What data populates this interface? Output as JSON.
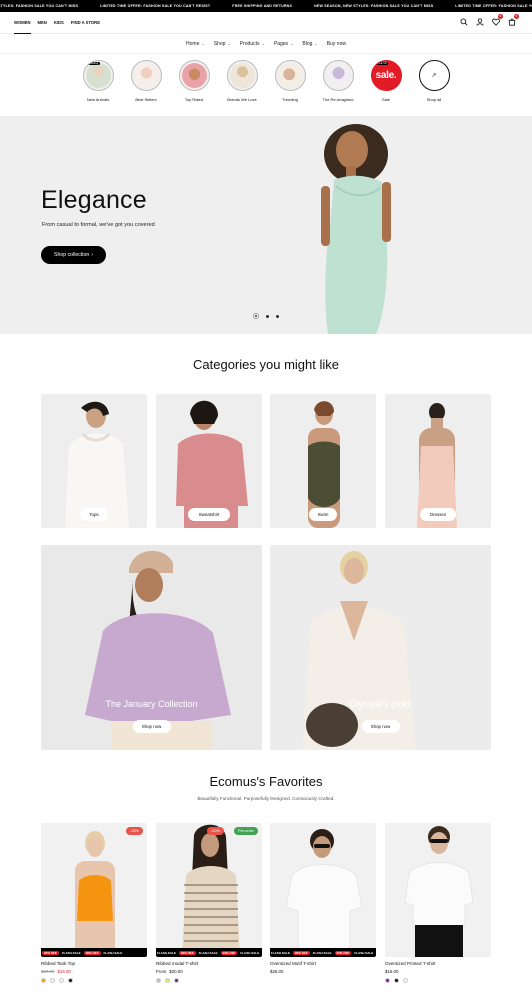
{
  "announcement": [
    "STYLES: FASHION SALE YOU CAN'T MISS",
    "LIMITED TIME OFFER: FASHION SALE YOU CAN'T RESIST",
    "FREE SHIPPING AND RETURNS",
    "NEW SEASON, NEW STYLES: FASHION SALE YOU CAN'T MISS",
    "LIMITED TIME OFFER: FASHION SALE YOU CAN'T RESIST"
  ],
  "topnav": [
    "WOMEN",
    "MEN",
    "KIDS",
    "FIND A STORE"
  ],
  "header": {
    "cart_count": "0",
    "wishlist_count": "0"
  },
  "mainnav": [
    {
      "label": "Home"
    },
    {
      "label": "Shop"
    },
    {
      "label": "Products"
    },
    {
      "label": "Pages"
    },
    {
      "label": "Blog"
    },
    {
      "label": "Buy now"
    }
  ],
  "stories": [
    {
      "label": "New Arrivals",
      "tag": "Trending"
    },
    {
      "label": "Best Sellers"
    },
    {
      "label": "Top Rated"
    },
    {
      "label": "Brands We Love"
    },
    {
      "label": "Trending"
    },
    {
      "label": "The Re-Imagined"
    },
    {
      "label": "Sale",
      "tag": "SALE UP",
      "circle_text": "sale."
    },
    {
      "label": "Shop all",
      "circle_text": "↗"
    }
  ],
  "hero": {
    "title": "Elegance",
    "subtitle": "From casual to formal, we've got you covered",
    "button": "Shop collection",
    "button_arrow": "›"
  },
  "categories": {
    "title": "Categories you might like",
    "items": [
      {
        "label": "Tops"
      },
      {
        "label": "Sweatshirt"
      },
      {
        "label": "Swim"
      },
      {
        "label": "Dresses"
      }
    ],
    "features": [
      {
        "caption": "The January Collection",
        "button": "Shop now"
      },
      {
        "caption": "Olympia's picks",
        "button": "Shop now"
      }
    ]
  },
  "favorites": {
    "title": "Ecomus's Favorites",
    "subtitle": "Beautifully Functional. Purposefully Designed. Consciously Crafted.",
    "products": [
      {
        "name": "Ribbed Tank Top",
        "old_price": "$20.00",
        "price": "$16.00",
        "badges": [
          {
            "text": "-33%",
            "color": "#e8534a"
          }
        ],
        "ticker": [
          "20% OFF",
          "FLASH SALE",
          "20% OFF",
          "FLASH SALE"
        ],
        "swatches": [
          "#f29a1f",
          "#f5f5f5",
          "#f7f2ee",
          "#111111"
        ]
      },
      {
        "name": "Ribbed modal T-shirt",
        "price_prefix": "From",
        "price": "$20.00",
        "badges": [
          {
            "text": "-20%",
            "color": "#e8534a"
          },
          {
            "text": "Pre-order",
            "color": "#3fa353"
          }
        ],
        "ticker": [
          "FLASH SALE",
          "20% OFF",
          "FLASH SALE",
          "20% OFF",
          "FLASH SALE"
        ],
        "swatches": [
          "#d9b99a",
          "#e6e65c",
          "#7a1f8f"
        ]
      },
      {
        "name": "Oversized Motif T-shirt",
        "price": "$25.00",
        "badges": [],
        "ticker": [
          "FLASH SALE",
          "20% OFF",
          "FLASH SALE",
          "20% OFF",
          "FLASH SALE"
        ],
        "swatches": []
      },
      {
        "name": "Oversized Printed T-shirt",
        "price": "$16.00",
        "badges": [],
        "ticker": [],
        "swatches": [
          "#7a1f8f",
          "#111111",
          "#f5f5f5"
        ]
      }
    ]
  }
}
